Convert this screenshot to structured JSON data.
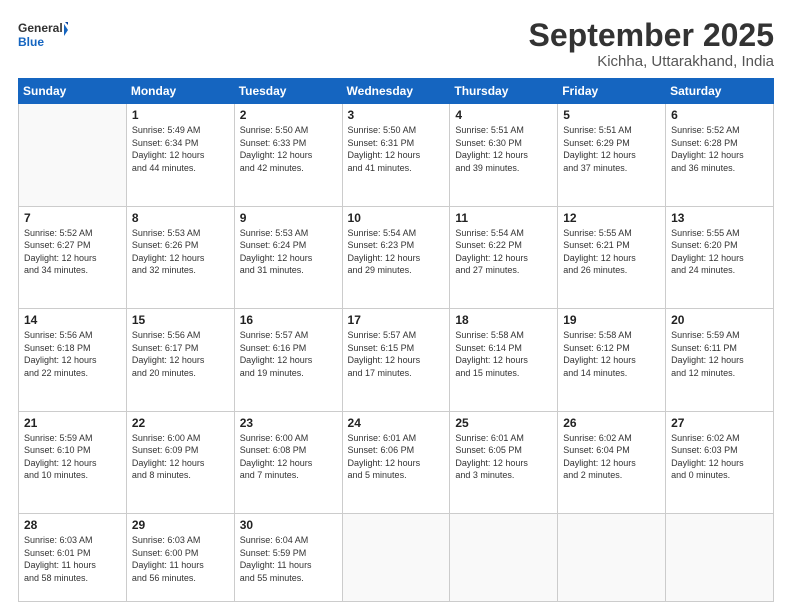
{
  "header": {
    "logo_general": "General",
    "logo_blue": "Blue",
    "month_title": "September 2025",
    "subtitle": "Kichha, Uttarakhand, India"
  },
  "weekdays": [
    "Sunday",
    "Monday",
    "Tuesday",
    "Wednesday",
    "Thursday",
    "Friday",
    "Saturday"
  ],
  "weeks": [
    [
      {
        "day": "",
        "info": ""
      },
      {
        "day": "1",
        "info": "Sunrise: 5:49 AM\nSunset: 6:34 PM\nDaylight: 12 hours\nand 44 minutes."
      },
      {
        "day": "2",
        "info": "Sunrise: 5:50 AM\nSunset: 6:33 PM\nDaylight: 12 hours\nand 42 minutes."
      },
      {
        "day": "3",
        "info": "Sunrise: 5:50 AM\nSunset: 6:31 PM\nDaylight: 12 hours\nand 41 minutes."
      },
      {
        "day": "4",
        "info": "Sunrise: 5:51 AM\nSunset: 6:30 PM\nDaylight: 12 hours\nand 39 minutes."
      },
      {
        "day": "5",
        "info": "Sunrise: 5:51 AM\nSunset: 6:29 PM\nDaylight: 12 hours\nand 37 minutes."
      },
      {
        "day": "6",
        "info": "Sunrise: 5:52 AM\nSunset: 6:28 PM\nDaylight: 12 hours\nand 36 minutes."
      }
    ],
    [
      {
        "day": "7",
        "info": "Sunrise: 5:52 AM\nSunset: 6:27 PM\nDaylight: 12 hours\nand 34 minutes."
      },
      {
        "day": "8",
        "info": "Sunrise: 5:53 AM\nSunset: 6:26 PM\nDaylight: 12 hours\nand 32 minutes."
      },
      {
        "day": "9",
        "info": "Sunrise: 5:53 AM\nSunset: 6:24 PM\nDaylight: 12 hours\nand 31 minutes."
      },
      {
        "day": "10",
        "info": "Sunrise: 5:54 AM\nSunset: 6:23 PM\nDaylight: 12 hours\nand 29 minutes."
      },
      {
        "day": "11",
        "info": "Sunrise: 5:54 AM\nSunset: 6:22 PM\nDaylight: 12 hours\nand 27 minutes."
      },
      {
        "day": "12",
        "info": "Sunrise: 5:55 AM\nSunset: 6:21 PM\nDaylight: 12 hours\nand 26 minutes."
      },
      {
        "day": "13",
        "info": "Sunrise: 5:55 AM\nSunset: 6:20 PM\nDaylight: 12 hours\nand 24 minutes."
      }
    ],
    [
      {
        "day": "14",
        "info": "Sunrise: 5:56 AM\nSunset: 6:18 PM\nDaylight: 12 hours\nand 22 minutes."
      },
      {
        "day": "15",
        "info": "Sunrise: 5:56 AM\nSunset: 6:17 PM\nDaylight: 12 hours\nand 20 minutes."
      },
      {
        "day": "16",
        "info": "Sunrise: 5:57 AM\nSunset: 6:16 PM\nDaylight: 12 hours\nand 19 minutes."
      },
      {
        "day": "17",
        "info": "Sunrise: 5:57 AM\nSunset: 6:15 PM\nDaylight: 12 hours\nand 17 minutes."
      },
      {
        "day": "18",
        "info": "Sunrise: 5:58 AM\nSunset: 6:14 PM\nDaylight: 12 hours\nand 15 minutes."
      },
      {
        "day": "19",
        "info": "Sunrise: 5:58 AM\nSunset: 6:12 PM\nDaylight: 12 hours\nand 14 minutes."
      },
      {
        "day": "20",
        "info": "Sunrise: 5:59 AM\nSunset: 6:11 PM\nDaylight: 12 hours\nand 12 minutes."
      }
    ],
    [
      {
        "day": "21",
        "info": "Sunrise: 5:59 AM\nSunset: 6:10 PM\nDaylight: 12 hours\nand 10 minutes."
      },
      {
        "day": "22",
        "info": "Sunrise: 6:00 AM\nSunset: 6:09 PM\nDaylight: 12 hours\nand 8 minutes."
      },
      {
        "day": "23",
        "info": "Sunrise: 6:00 AM\nSunset: 6:08 PM\nDaylight: 12 hours\nand 7 minutes."
      },
      {
        "day": "24",
        "info": "Sunrise: 6:01 AM\nSunset: 6:06 PM\nDaylight: 12 hours\nand 5 minutes."
      },
      {
        "day": "25",
        "info": "Sunrise: 6:01 AM\nSunset: 6:05 PM\nDaylight: 12 hours\nand 3 minutes."
      },
      {
        "day": "26",
        "info": "Sunrise: 6:02 AM\nSunset: 6:04 PM\nDaylight: 12 hours\nand 2 minutes."
      },
      {
        "day": "27",
        "info": "Sunrise: 6:02 AM\nSunset: 6:03 PM\nDaylight: 12 hours\nand 0 minutes."
      }
    ],
    [
      {
        "day": "28",
        "info": "Sunrise: 6:03 AM\nSunset: 6:01 PM\nDaylight: 11 hours\nand 58 minutes."
      },
      {
        "day": "29",
        "info": "Sunrise: 6:03 AM\nSunset: 6:00 PM\nDaylight: 11 hours\nand 56 minutes."
      },
      {
        "day": "30",
        "info": "Sunrise: 6:04 AM\nSunset: 5:59 PM\nDaylight: 11 hours\nand 55 minutes."
      },
      {
        "day": "",
        "info": ""
      },
      {
        "day": "",
        "info": ""
      },
      {
        "day": "",
        "info": ""
      },
      {
        "day": "",
        "info": ""
      }
    ]
  ]
}
